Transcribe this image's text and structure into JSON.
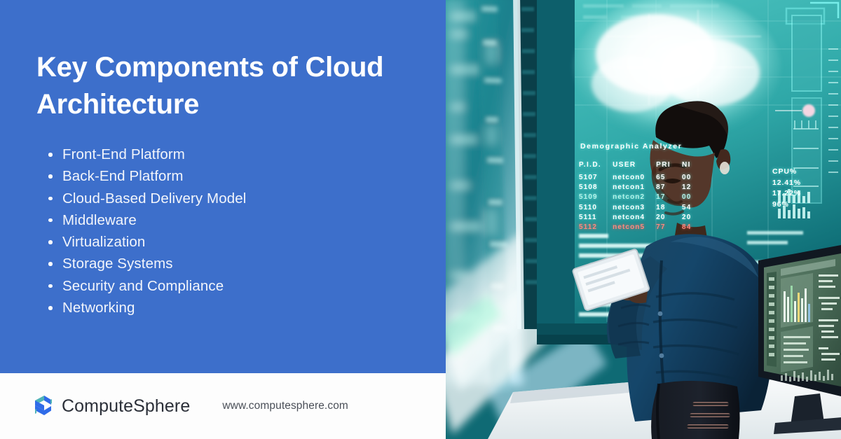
{
  "slide": {
    "title": "Key Components of Cloud\nArchitecture",
    "bullets": [
      "Front-End Platform",
      "Back-End Platform",
      "Cloud-Based Delivery Model",
      "Middleware",
      "Virtualization",
      "Storage Systems",
      "Security and Compliance",
      "Networking"
    ],
    "accent_color": "#3D6FCB"
  },
  "footer": {
    "brand_name": "ComputeSphere",
    "site_url": "www.computesphere.com",
    "logo_primary_color": "#2F6BE8",
    "logo_accent_color": "#4FB3B8"
  },
  "photo": {
    "alt": "Woman in denim shirt holding a tablet in front of large teal data-center monitors",
    "screen": {
      "panel_title": "Demographic Analyzer",
      "table": {
        "columns": [
          "P.I.D.",
          "USER",
          "PRI",
          "NI"
        ],
        "rows": [
          [
            "5107",
            "netcon0",
            "65",
            "00"
          ],
          [
            "5108",
            "netcon1",
            "87",
            "12"
          ],
          [
            "5109",
            "netcon2",
            "17",
            "00"
          ],
          [
            "5110",
            "netcon3",
            "18",
            "54"
          ],
          [
            "5111",
            "netcon4",
            "20",
            "20"
          ],
          [
            "5112",
            "netcon5",
            "77",
            "84"
          ]
        ],
        "alert_row_index": 5,
        "dim_row_index": 2
      },
      "cpu_panel": {
        "label": "CPU%",
        "values": [
          "12.41%",
          "17.22%",
          "96%"
        ]
      }
    }
  }
}
